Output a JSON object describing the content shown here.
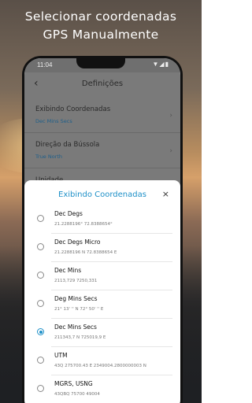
{
  "headline": {
    "line1": "Selecionar coordenadas",
    "line2": "GPS Manualmente"
  },
  "statusbar": {
    "time": "11:04",
    "icons": "▼◢▮"
  },
  "settings": {
    "title": "Definições",
    "back_icon": "‹",
    "items": [
      {
        "label": "Exibindo Coordenadas",
        "value": "Dec Mins Secs"
      },
      {
        "label": "Direção da Bússola",
        "value": "True North"
      },
      {
        "label": "Unidade",
        "value": ""
      }
    ]
  },
  "sheet": {
    "title": "Exibindo Coordenadas",
    "close": "×",
    "selected_index": 4,
    "options": [
      {
        "label": "Dec Degs",
        "sub": "21.2288196°  72.8388654°"
      },
      {
        "label": "Dec Degs Micro",
        "sub": "21.2288196 N   72.8388654 E"
      },
      {
        "label": "Dec Mins",
        "sub": "2113,729   7250,331"
      },
      {
        "label": "Deg Mins Secs",
        "sub": "21° 13' '' N   72° 50' '' E"
      },
      {
        "label": "Dec Mins Secs",
        "sub": "211343,7 N   725019,9 E"
      },
      {
        "label": "UTM",
        "sub": "43Q   275700.43 E   2349004.2800000003 N"
      },
      {
        "label": "MGRS, USNG",
        "sub": "43QBQ 75700 49004"
      }
    ]
  },
  "colors": {
    "accent": "#1e90c8",
    "overlay": "#7a7a7a"
  }
}
